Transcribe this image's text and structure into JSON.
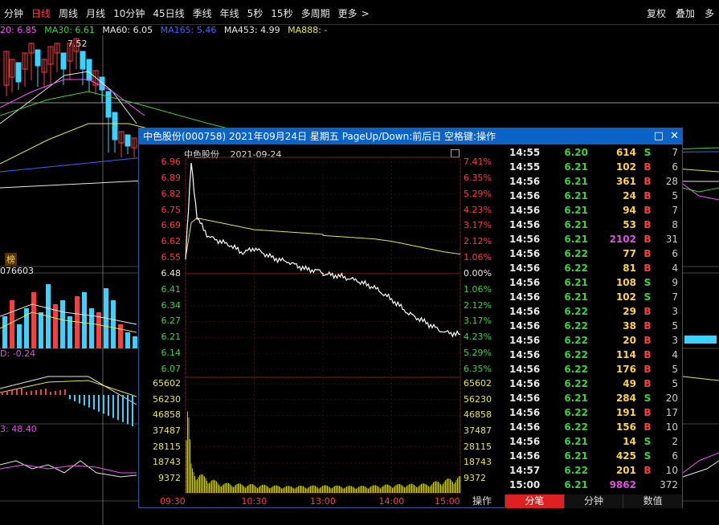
{
  "toolbar": {
    "tabs": [
      {
        "label": "分钟",
        "active": false
      },
      {
        "label": "日线",
        "active": true
      },
      {
        "label": "周线",
        "active": false
      },
      {
        "label": "月线",
        "active": false
      },
      {
        "label": "10分钟",
        "active": false
      },
      {
        "label": "45日线",
        "active": false
      },
      {
        "label": "季线",
        "active": false
      },
      {
        "label": "年线",
        "active": false
      },
      {
        "label": "5秒",
        "active": false
      },
      {
        "label": "15秒",
        "active": false
      },
      {
        "label": "多周期",
        "active": false
      },
      {
        "label": "更多",
        "active": false
      }
    ],
    "more_arrow": ">",
    "right": [
      "复权",
      "叠加",
      "多"
    ]
  },
  "ma_legend": {
    "ma20": "20: 6.85",
    "ma30": "MA30: 6.61",
    "ma60": "MA60: 6.05",
    "ma165": "MA165: 5.46",
    "ma453": "MA453: 4.99",
    "ma888": "MA888: -"
  },
  "main_chart": {
    "high_label": "7.52"
  },
  "left_labels": {
    "rank": "榜",
    "vol": "076603",
    "macd": "D: -0.24",
    "rsi": "3: 48.40"
  },
  "popup": {
    "title": "中色股份(000758) 2021年09月24日 星期五 PageUp/Down:前后日 空格键:操作",
    "stock_name": "中色股份",
    "date": "2021-09-24",
    "close_btn": "✕",
    "max_btn": "□",
    "price_axis": [
      "6.96",
      "6.89",
      "6.82",
      "6.75",
      "6.69",
      "6.62",
      "6.55",
      "6.48",
      "6.41",
      "6.34",
      "6.27",
      "6.21",
      "6.14",
      "6.07"
    ],
    "pct_axis": [
      "7.41%",
      "6.35%",
      "5.29%",
      "4.23%",
      "3.17%",
      "2.12%",
      "1.06%",
      "0.00%",
      "1.06%",
      "2.12%",
      "3.17%",
      "4.23%",
      "5.29%",
      "6.35%"
    ],
    "vol_axis": [
      "65602",
      "56230",
      "46858",
      "37487",
      "28115",
      "18743",
      "9372"
    ],
    "time_axis": [
      "09:30",
      "10:30",
      "13:00",
      "14:00",
      "15:00"
    ],
    "op_label": "操作"
  },
  "ticks": [
    {
      "time": "14:55",
      "price": "6.20",
      "vol": "614",
      "bs": "S",
      "n": "7"
    },
    {
      "time": "14:55",
      "price": "6.21",
      "vol": "102",
      "bs": "B",
      "n": "6"
    },
    {
      "time": "14:56",
      "price": "6.21",
      "vol": "361",
      "bs": "B",
      "n": "28"
    },
    {
      "time": "14:56",
      "price": "6.21",
      "vol": "24",
      "bs": "B",
      "n": "5"
    },
    {
      "time": "14:56",
      "price": "6.21",
      "vol": "94",
      "bs": "B",
      "n": "7"
    },
    {
      "time": "14:56",
      "price": "6.21",
      "vol": "53",
      "bs": "B",
      "n": "8"
    },
    {
      "time": "14:56",
      "price": "6.21",
      "vol": "2102",
      "bs": "B",
      "n": "31"
    },
    {
      "time": "14:56",
      "price": "6.22",
      "vol": "77",
      "bs": "B",
      "n": "6"
    },
    {
      "time": "14:56",
      "price": "6.22",
      "vol": "81",
      "bs": "B",
      "n": "4"
    },
    {
      "time": "14:56",
      "price": "6.21",
      "vol": "108",
      "bs": "S",
      "n": "9"
    },
    {
      "time": "14:56",
      "price": "6.21",
      "vol": "102",
      "bs": "S",
      "n": "7"
    },
    {
      "time": "14:56",
      "price": "6.22",
      "vol": "29",
      "bs": "B",
      "n": "3"
    },
    {
      "time": "14:56",
      "price": "6.22",
      "vol": "38",
      "bs": "B",
      "n": "5"
    },
    {
      "time": "14:56",
      "price": "6.22",
      "vol": "20",
      "bs": "B",
      "n": "3"
    },
    {
      "time": "14:56",
      "price": "6.22",
      "vol": "114",
      "bs": "B",
      "n": "4"
    },
    {
      "time": "14:56",
      "price": "6.22",
      "vol": "176",
      "bs": "B",
      "n": "5"
    },
    {
      "time": "14:56",
      "price": "6.22",
      "vol": "49",
      "bs": "B",
      "n": "5"
    },
    {
      "time": "14:56",
      "price": "6.21",
      "vol": "284",
      "bs": "S",
      "n": "20"
    },
    {
      "time": "14:56",
      "price": "6.22",
      "vol": "191",
      "bs": "B",
      "n": "17"
    },
    {
      "time": "14:56",
      "price": "6.22",
      "vol": "156",
      "bs": "B",
      "n": "10"
    },
    {
      "time": "14:56",
      "price": "6.21",
      "vol": "14",
      "bs": "S",
      "n": "2"
    },
    {
      "time": "14:56",
      "price": "6.21",
      "vol": "425",
      "bs": "S",
      "n": "6"
    },
    {
      "time": "14:57",
      "price": "6.22",
      "vol": "201",
      "bs": "B",
      "n": "10"
    },
    {
      "time": "15:00",
      "price": "6.21",
      "vol": "9862",
      "bs": "",
      "n": "372"
    }
  ],
  "tick_tabs": [
    {
      "label": "分笔",
      "active": true
    },
    {
      "label": "分钟",
      "active": false
    },
    {
      "label": "数值",
      "active": false
    }
  ],
  "colors": {
    "up": "#ff3c3c",
    "down": "#3cd23c",
    "buy": "#ff3c3c",
    "sell": "#3cd23c",
    "price_line": "#ffffff",
    "avg_line": "#e8e83c",
    "volume": "#c8c800"
  },
  "chart_data": {
    "type": "line",
    "title": "中色股份 2021-09-24",
    "prev_close": 6.48,
    "ylim": [
      6.07,
      6.96
    ],
    "x": [
      "09:30",
      "09:35",
      "09:40",
      "09:50",
      "10:00",
      "10:10",
      "10:20",
      "10:30",
      "10:45",
      "11:00",
      "11:15",
      "11:30",
      "13:00",
      "13:15",
      "13:30",
      "13:45",
      "14:00",
      "14:15",
      "14:30",
      "14:45",
      "15:00"
    ],
    "series": [
      {
        "values": [
          6.55,
          6.96,
          6.72,
          6.64,
          6.62,
          6.6,
          6.57,
          6.59,
          6.55,
          6.53,
          6.5,
          6.49,
          6.48,
          6.47,
          6.45,
          6.42,
          6.37,
          6.31,
          6.27,
          6.23,
          6.22
        ]
      },
      {
        "values": [
          6.55,
          6.7,
          6.72,
          6.71,
          6.7,
          6.69,
          6.68,
          6.67,
          6.665,
          6.66,
          6.655,
          6.65,
          6.645,
          6.64,
          6.635,
          6.63,
          6.62,
          6.605,
          6.59,
          6.575,
          6.565
        ]
      }
    ],
    "volume": {
      "x": [
        "09:30",
        "09:32",
        "09:35",
        "09:40",
        "10:00",
        "10:30",
        "11:00",
        "13:00",
        "13:30",
        "14:00",
        "14:30",
        "15:00"
      ],
      "values": [
        28000,
        55000,
        16000,
        12000,
        6000,
        5000,
        4000,
        4500,
        4000,
        5000,
        5500,
        9862
      ],
      "ylim": [
        0,
        65602
      ]
    }
  }
}
